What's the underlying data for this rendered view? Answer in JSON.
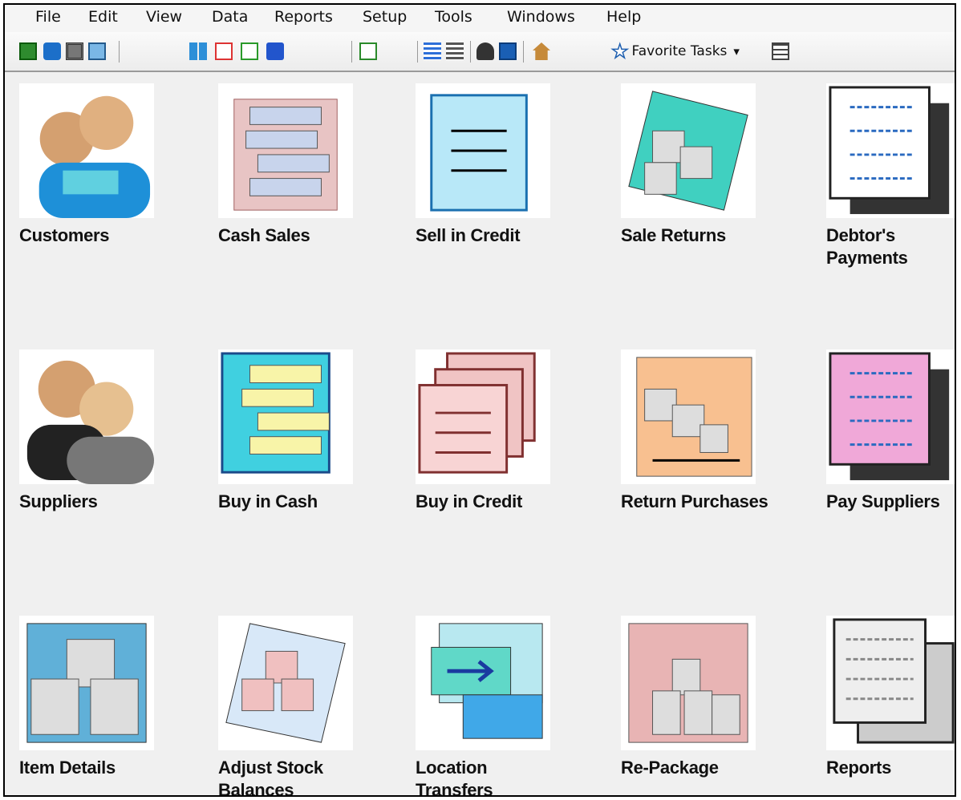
{
  "menu": [
    "File",
    "Edit",
    "View",
    "Data",
    "Reports",
    "Setup",
    "Tools",
    "Windows",
    "Help"
  ],
  "toolbar": {
    "favorite_label": "Favorite Tasks",
    "favorite_arrow": "▾"
  },
  "tiles": [
    {
      "label": "Customers",
      "icon": "customers-icon"
    },
    {
      "label": "Cash Sales",
      "icon": "cash-sales-icon"
    },
    {
      "label": "Sell in Credit",
      "icon": "sell-in-credit-icon"
    },
    {
      "label": "Sale Returns",
      "icon": "sale-returns-icon"
    },
    {
      "label": "Debtor's Payments",
      "icon": "debtors-payments-icon"
    },
    {
      "label": "Suppliers",
      "icon": "suppliers-icon"
    },
    {
      "label": "Buy in Cash",
      "icon": "buy-in-cash-icon"
    },
    {
      "label": "Buy in Credit",
      "icon": "buy-in-credit-icon"
    },
    {
      "label": "Return Purchases",
      "icon": "return-purchases-icon"
    },
    {
      "label": "Pay Suppliers",
      "icon": "pay-suppliers-icon"
    },
    {
      "label": "Item Details",
      "icon": "item-details-icon"
    },
    {
      "label": "Adjust Stock Balances",
      "icon": "adjust-stock-icon"
    },
    {
      "label": "Location Transfers",
      "icon": "location-transfers-icon"
    },
    {
      "label": "Re-Package",
      "icon": "re-package-icon"
    },
    {
      "label": "Reports",
      "icon": "reports-icon"
    }
  ]
}
